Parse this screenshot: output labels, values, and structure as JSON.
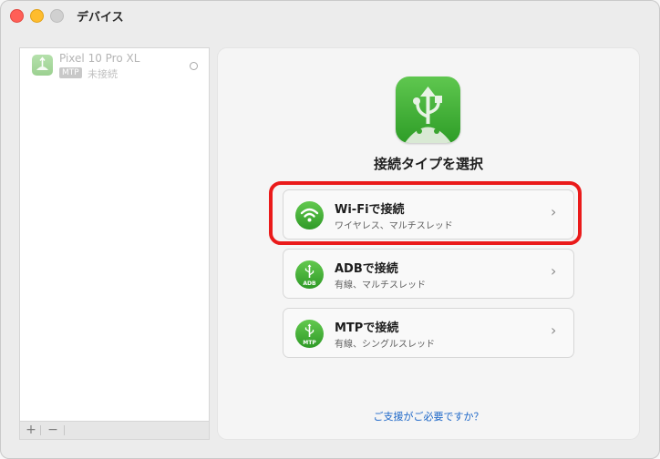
{
  "window": {
    "title": "デバイス"
  },
  "sidebar": {
    "devices": [
      {
        "name": "Pixel 10 Pro XL",
        "badge": "MTP",
        "status": "未接続"
      }
    ],
    "add_label": "+",
    "remove_label": "−"
  },
  "main": {
    "title": "接続タイプを選択",
    "options": [
      {
        "title": "Wi-Fiで接続",
        "subtitle": "ワイヤレス、マルチスレッド",
        "icon": "wifi-icon"
      },
      {
        "title": "ADBで接続",
        "subtitle": "有線、マルチスレッド",
        "icon": "usb-icon",
        "icon_label": "ADB"
      },
      {
        "title": "MTPで接続",
        "subtitle": "有線、シングルスレッド",
        "icon": "usb-icon",
        "icon_label": "MTP"
      }
    ],
    "help_link": "ご支援がご必要ですか？"
  },
  "colors": {
    "accent_green": "#3aad2f",
    "highlight_red": "#ea1a1a",
    "link_blue": "#1d67c8"
  }
}
